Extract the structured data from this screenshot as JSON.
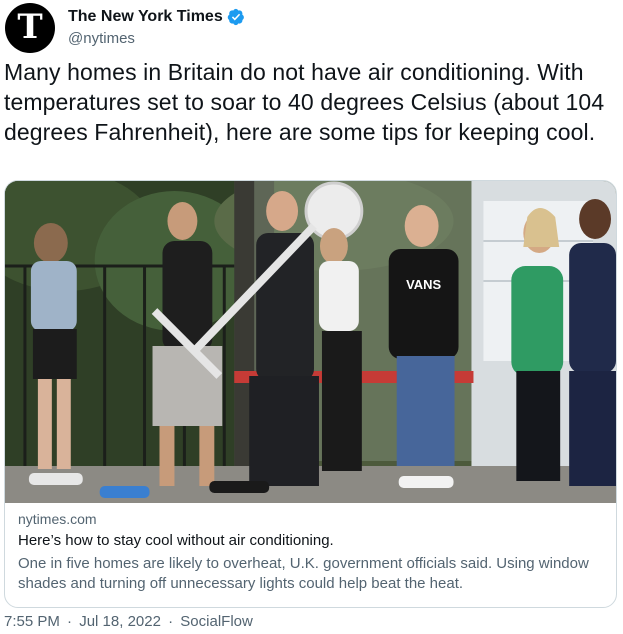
{
  "tweet": {
    "author": {
      "display_name": "The New York Times",
      "handle": "@nytimes",
      "avatar_glyph": "T",
      "verified": true,
      "verified_color": "#1d9bf0"
    },
    "text": "Many homes in Britain do not have air conditioning. With temperatures set to soar to 40 degrees Celsius (about 104 degrees Fahrenheit), here are some tips for keeping cool.",
    "card": {
      "domain": "nytimes.com",
      "title": "Here’s how to stay cool without air conditioning.",
      "description": "One in five homes are likely to overheat, U.K. government officials said. Using window shades and turning off unnecessary lights could help beat the heat.",
      "image_shirt_text": "VANS"
    },
    "meta": {
      "time": "7:55 PM",
      "date": "Jul 18, 2022",
      "source": "SocialFlow",
      "separator": "·"
    }
  },
  "colors": {
    "text": "#0f1419",
    "secondary": "#536471",
    "border": "#cfd9de"
  }
}
